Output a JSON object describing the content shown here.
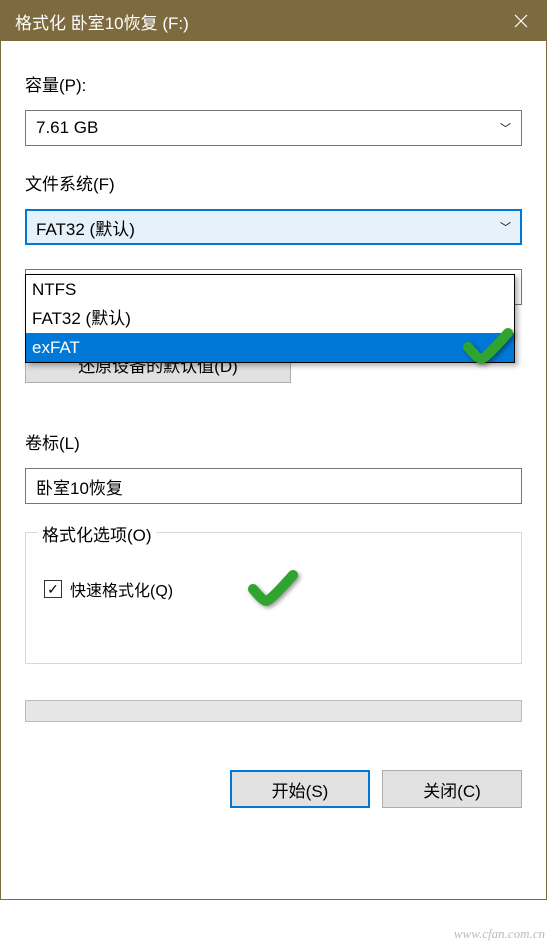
{
  "title": "格式化 卧室10恢复 (F:)",
  "capacity": {
    "label": "容量(P):",
    "value": "7.61 GB"
  },
  "filesystem": {
    "label": "文件系统(F)",
    "value": "FAT32 (默认)",
    "options": [
      "NTFS",
      "FAT32 (默认)",
      "exFAT"
    ],
    "selected_option": "exFAT"
  },
  "restore_button": "还原设备的默认值(D)",
  "volume_label": {
    "label": "卷标(L)",
    "value": "卧室10恢复"
  },
  "format_options": {
    "legend": "格式化选项(O)",
    "quick_format": "快速格式化(Q)"
  },
  "buttons": {
    "start": "开始(S)",
    "close": "关闭(C)"
  },
  "watermark": "www.cfan.com.cn"
}
